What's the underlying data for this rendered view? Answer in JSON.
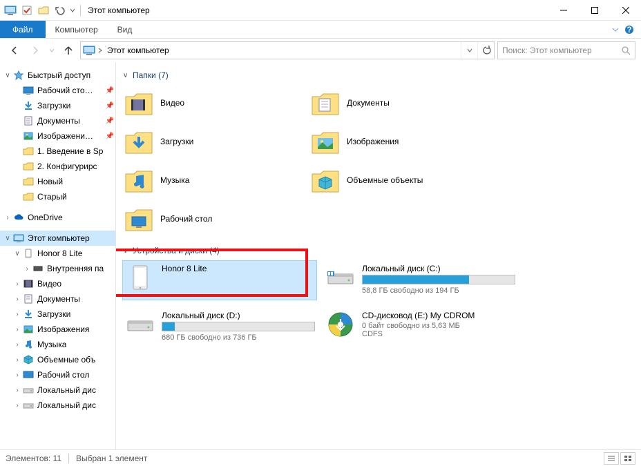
{
  "titlebar": {
    "title": "Этот компьютер"
  },
  "ribbon": {
    "file": "Файл",
    "computer": "Компьютер",
    "view": "Вид"
  },
  "address": {
    "crumb": "Этот компьютер"
  },
  "search": {
    "placeholder": "Поиск: Этот компьютер"
  },
  "sidebar": {
    "quick_access": "Быстрый доступ",
    "desktop": "Рабочий сто…",
    "downloads": "Загрузки",
    "documents": "Документы",
    "pictures": "Изображени…",
    "folder1": "1. Введение в Sp",
    "folder2": "2. Конфигурирс",
    "folder_new": "Новый",
    "folder_old": "Старый",
    "onedrive": "OneDrive",
    "this_pc": "Этот компьютер",
    "honor": "Honor 8 Lite",
    "internal": "Внутренняя па",
    "videos": "Видео",
    "documents2": "Документы",
    "downloads2": "Загрузки",
    "pictures2": "Изображения",
    "music": "Музыка",
    "objects3d": "Объемные объ",
    "desktop2": "Рабочий стол",
    "localc": "Локальный дис",
    "locald": "Локальный дис"
  },
  "content": {
    "folders_header": "Папки (7)",
    "drives_header": "Устройства и диски (4)",
    "folders": {
      "videos": "Видео",
      "documents": "Документы",
      "downloads": "Загрузки",
      "pictures": "Изображения",
      "music": "Музыка",
      "objects3d": "Объемные объекты",
      "desktop": "Рабочий стол"
    },
    "drives": {
      "honor": {
        "name": "Honor 8 Lite"
      },
      "c": {
        "name": "Локальный диск (C:)",
        "free": "58,8 ГБ свободно из 194 ГБ",
        "fill": 70
      },
      "d": {
        "name": "Локальный диск (D:)",
        "free": "680 ГБ свободно из 736 ГБ",
        "fill": 8
      },
      "cd": {
        "name": "CD-дисковод (E:) My CDROM",
        "free": "0 байт свободно из 5,63 МБ",
        "fs": "CDFS"
      }
    }
  },
  "statusbar": {
    "elements": "Элементов: 11",
    "selected": "Выбран 1 элемент"
  }
}
